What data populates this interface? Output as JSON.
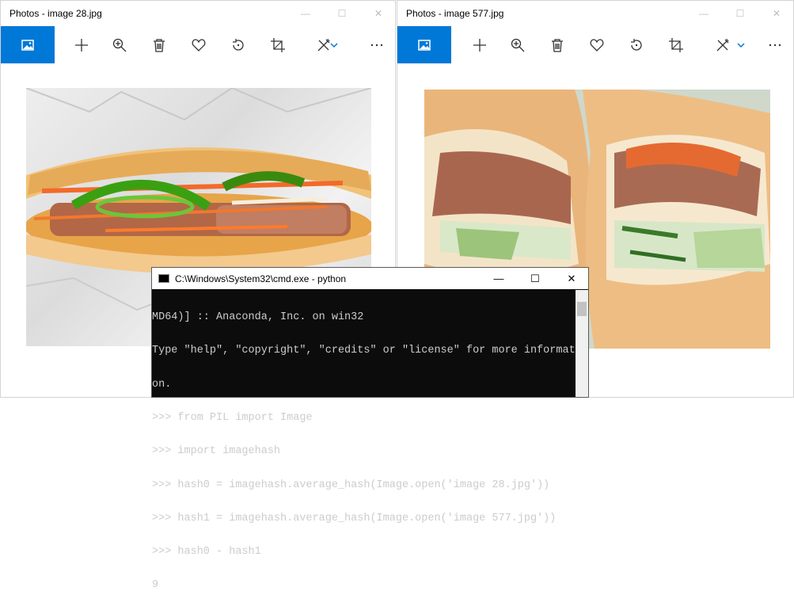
{
  "window1": {
    "title": "Photos - image 28.jpg",
    "toolbar": [
      "image-icon",
      "add-icon",
      "zoom-icon",
      "delete-icon",
      "heart-icon",
      "rotate-icon",
      "crop-icon",
      "edit-icon",
      "more-icon"
    ]
  },
  "window2": {
    "title": "Photos - image 577.jpg",
    "toolbar": [
      "image-icon",
      "add-icon",
      "zoom-icon",
      "delete-icon",
      "heart-icon",
      "rotate-icon",
      "crop-icon",
      "edit-icon",
      "more-icon"
    ]
  },
  "controls": {
    "minimize": "—",
    "maximize": "☐",
    "close": "✕"
  },
  "cmd": {
    "title": "C:\\Windows\\System32\\cmd.exe - python",
    "lines": [
      "MD64)] :: Anaconda, Inc. on win32",
      "Type \"help\", \"copyright\", \"credits\" or \"license\" for more informati",
      "on.",
      ">>> from PIL import Image",
      ">>> import imagehash",
      ">>> hash0 = imagehash.average_hash(Image.open('image 28.jpg'))",
      ">>> hash1 = imagehash.average_hash(Image.open('image 577.jpg'))",
      ">>> hash0 - hash1",
      "9"
    ]
  },
  "colors": {
    "accent": "#0078d7",
    "console_bg": "#0c0c0c",
    "console_text": "#cccccc"
  }
}
